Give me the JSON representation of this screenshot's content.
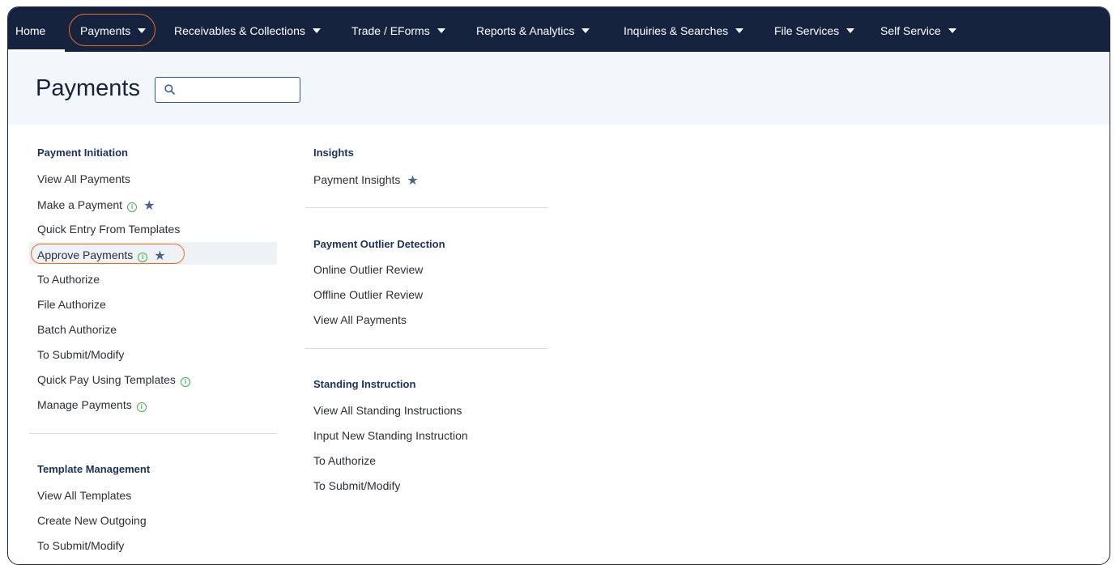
{
  "nav": {
    "items": [
      {
        "label": "Home",
        "has_caret": false
      },
      {
        "label": "Payments",
        "has_caret": true
      },
      {
        "label": "Receivables & Collections",
        "has_caret": true
      },
      {
        "label": "Trade / EForms",
        "has_caret": true
      },
      {
        "label": "Reports & Analytics",
        "has_caret": true
      },
      {
        "label": "Inquiries & Searches",
        "has_caret": true
      },
      {
        "label": "File Services",
        "has_caret": true
      },
      {
        "label": "Self Service",
        "has_caret": true
      }
    ]
  },
  "page": {
    "title": "Payments",
    "search_value": "",
    "search_icon": "search-icon"
  },
  "sections": {
    "payment_initiation": {
      "title": "Payment Initiation",
      "items": [
        {
          "label": "View All Payments"
        },
        {
          "label": "Make a Payment",
          "info": true,
          "star": true
        },
        {
          "label": "Quick Entry From Templates"
        },
        {
          "label": "Approve Payments",
          "info": true,
          "star": true
        },
        {
          "label": "To Authorize"
        },
        {
          "label": "File Authorize"
        },
        {
          "label": "Batch Authorize"
        },
        {
          "label": "To Submit/Modify"
        },
        {
          "label": "Quick Pay Using Templates",
          "info": true
        },
        {
          "label": "Manage Payments",
          "info": true
        }
      ]
    },
    "template_management": {
      "title": "Template Management",
      "items": [
        {
          "label": "View All Templates"
        },
        {
          "label": "Create New Outgoing"
        },
        {
          "label": "To Submit/Modify"
        }
      ]
    },
    "insights": {
      "title": "Insights",
      "items": [
        {
          "label": "Payment Insights",
          "star": true
        }
      ]
    },
    "payment_outlier_detection": {
      "title": "Payment Outlier Detection",
      "items": [
        {
          "label": "Online Outlier Review"
        },
        {
          "label": "Offline Outlier Review"
        },
        {
          "label": "View All Payments"
        }
      ]
    },
    "standing_instruction": {
      "title": "Standing Instruction",
      "items": [
        {
          "label": "View All Standing Instructions"
        },
        {
          "label": "Input New Standing Instruction"
        },
        {
          "label": "To Authorize"
        },
        {
          "label": "To Submit/Modify"
        }
      ]
    }
  },
  "colors": {
    "nav_bg": "#15233f",
    "highlight_ring": "#f26a21",
    "section_title": "#1c3461",
    "info_icon": "#3fb24a",
    "star_icon": "#4b6588"
  },
  "icons": {
    "info": "info-circle-icon",
    "star": "star-icon",
    "caret": "caret-down-icon"
  }
}
